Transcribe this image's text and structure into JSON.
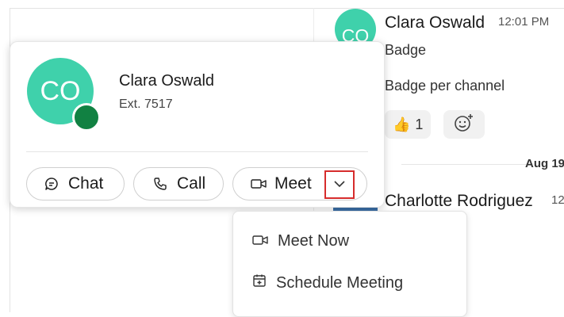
{
  "chat_pane": {
    "message": {
      "avatar_initials": "CO",
      "author": "Clara Oswald",
      "time": "12:01 PM",
      "line1": "Badge",
      "line2": "Badge per channel",
      "reaction_emoji": "👍",
      "reaction_count": "1",
      "add_reaction_icon": "add-emoji-icon"
    },
    "date_separator": "Aug 19",
    "next_message": {
      "author": "Charlotte Rodriguez",
      "time": "12"
    }
  },
  "profile_card": {
    "avatar_initials": "CO",
    "presence_color": "#118142",
    "name": "Clara Oswald",
    "extension": "Ext. 7517",
    "actions": {
      "chat_label": "Chat",
      "call_label": "Call",
      "meet_label": "Meet"
    }
  },
  "meet_menu": {
    "items": [
      {
        "label": "Meet Now",
        "icon": "video-camera-icon"
      },
      {
        "label": "Schedule Meeting",
        "icon": "calendar-icon"
      }
    ]
  },
  "colors": {
    "avatar": "#3fd1ab",
    "highlight_border": "#d62c2c"
  }
}
